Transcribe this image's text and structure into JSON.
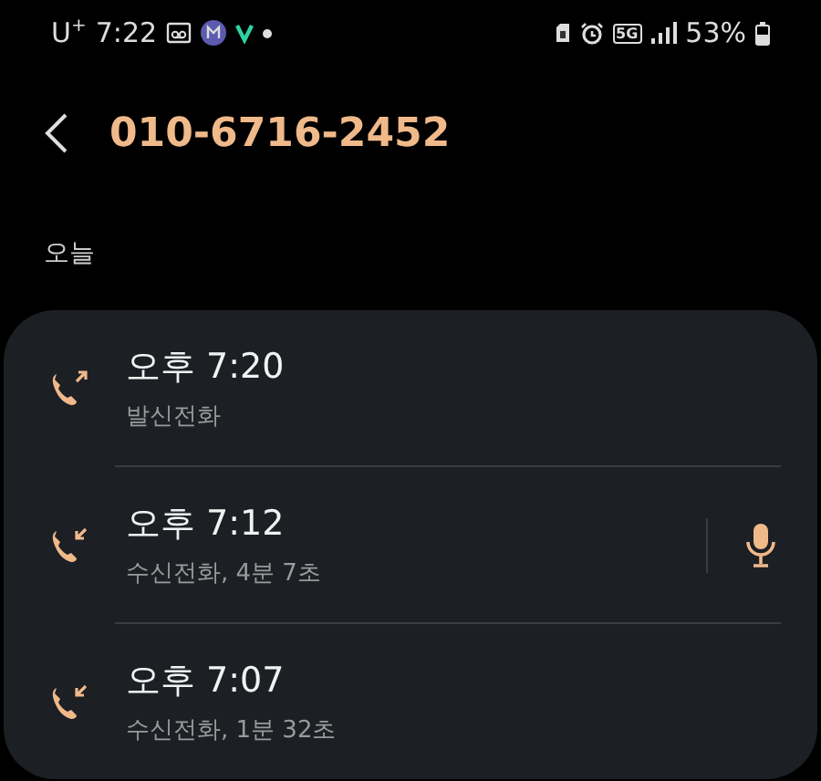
{
  "status_bar": {
    "carrier": "U$^{+}$",
    "time": "7:22",
    "network": "5G",
    "battery": "53%"
  },
  "header": {
    "title": "010-6716-2452"
  },
  "section": {
    "label": "오늘"
  },
  "calls": [
    {
      "kind": "outgoing",
      "time": "오후 7:20",
      "detail": "발신전화",
      "recording": false
    },
    {
      "kind": "incoming",
      "time": "오후 7:12",
      "detail": "수신전화, 4분 7초",
      "recording": true
    },
    {
      "kind": "incoming",
      "time": "오후 7:07",
      "detail": "수신전화, 1분 32초",
      "recording": false
    }
  ]
}
